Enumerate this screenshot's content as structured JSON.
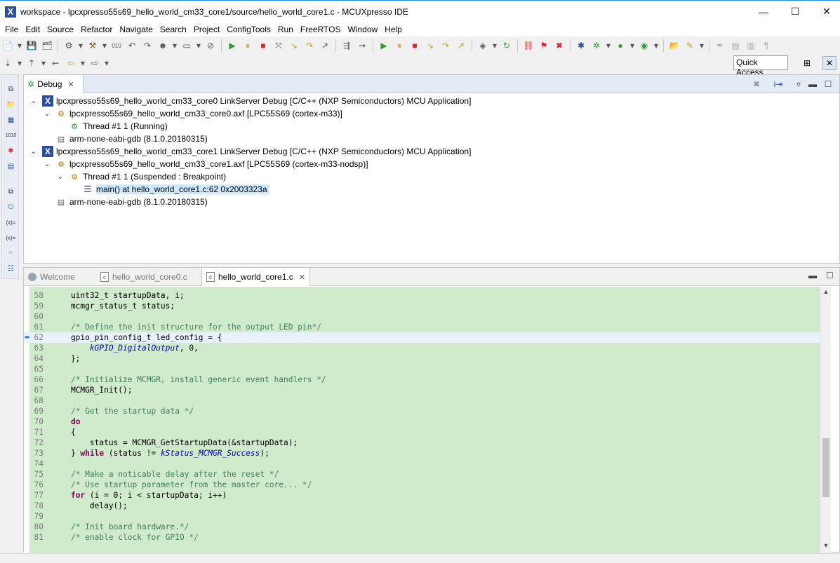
{
  "window": {
    "title": "workspace - lpcxpresso55s69_hello_world_cm33_core1/source/hello_world_core1.c - MCUXpresso IDE",
    "minimize": "—",
    "maximize": "☐",
    "close": "✕"
  },
  "menu": [
    "File",
    "Edit",
    "Source",
    "Refactor",
    "Navigate",
    "Search",
    "Project",
    "ConfigTools",
    "Run",
    "FreeRTOS",
    "Window",
    "Help"
  ],
  "toolbar": {
    "quick_access": "Quick Access"
  },
  "debug_view": {
    "tab_label": "Debug",
    "tree": [
      {
        "level": 0,
        "twisty": "⌄",
        "icon": "launch-icon",
        "glyph": "X",
        "text": "lpcxpresso55s69_hello_world_cm33_core0 LinkServer Debug [C/C++ (NXP Semiconductors) MCU Application]"
      },
      {
        "level": 1,
        "twisty": "⌄",
        "icon": "process-icon",
        "glyph": "⚙",
        "text": "lpcxpresso55s69_hello_world_cm33_core0.axf [LPC55S69 (cortex-m33)]"
      },
      {
        "level": 2,
        "twisty": "",
        "icon": "thread-running-icon",
        "glyph": "⚙",
        "text": "Thread #1 1 (Running)"
      },
      {
        "level": 1,
        "twisty": "",
        "icon": "gdb-icon",
        "glyph": "▤",
        "text": "arm-none-eabi-gdb (8.1.0.20180315)"
      },
      {
        "level": 0,
        "twisty": "⌄",
        "icon": "launch-icon",
        "glyph": "X",
        "text": "lpcxpresso55s69_hello_world_cm33_core1 LinkServer Debug [C/C++ (NXP Semiconductors) MCU Application]"
      },
      {
        "level": 1,
        "twisty": "⌄",
        "icon": "process-icon",
        "glyph": "⚙",
        "text": "lpcxpresso55s69_hello_world_cm33_core1.axf [LPC55S69 (cortex-m33-nodsp)]"
      },
      {
        "level": 2,
        "twisty": "⌄",
        "icon": "thread-suspended-icon",
        "glyph": "⚙",
        "text": "Thread #1 1 (Suspended : Breakpoint)"
      },
      {
        "level": 3,
        "twisty": "",
        "icon": "stack-frame-icon",
        "glyph": "☰",
        "text": "main() at hello_world_core1.c:62 0x2003323a",
        "selected": true
      },
      {
        "level": 1,
        "twisty": "",
        "icon": "gdb-icon",
        "glyph": "▤",
        "text": "arm-none-eabi-gdb (8.1.0.20180315)"
      }
    ]
  },
  "editor": {
    "tabs": [
      {
        "label": "Welcome",
        "kind": "welcome",
        "active": false
      },
      {
        "label": "hello_world_core0.c",
        "kind": "c-file",
        "active": false
      },
      {
        "label": "hello_world_core1.c",
        "kind": "c-file",
        "active": true
      }
    ],
    "current_line": "62",
    "lines": [
      {
        "n": "58",
        "code": "    uint32_t startupData, i;"
      },
      {
        "n": "59",
        "code": "    mcmgr_status_t status;"
      },
      {
        "n": "60",
        "code": ""
      },
      {
        "n": "61",
        "code": "    /* Define the init structure for the output LED pin*/"
      },
      {
        "n": "62",
        "code": "    gpio_pin_config_t led_config = {"
      },
      {
        "n": "63",
        "code": "        kGPIO_DigitalOutput, 0,"
      },
      {
        "n": "64",
        "code": "    };"
      },
      {
        "n": "65",
        "code": ""
      },
      {
        "n": "66",
        "code": "    /* Initialize MCMGR, install generic event handlers */"
      },
      {
        "n": "67",
        "code": "    MCMGR_Init();"
      },
      {
        "n": "68",
        "code": ""
      },
      {
        "n": "69",
        "code": "    /* Get the startup data */"
      },
      {
        "n": "70",
        "code": "    do"
      },
      {
        "n": "71",
        "code": "    {"
      },
      {
        "n": "72",
        "code": "        status = MCMGR_GetStartupData(&startupData);"
      },
      {
        "n": "73",
        "code": "    } while (status != kStatus_MCMGR_Success);"
      },
      {
        "n": "74",
        "code": ""
      },
      {
        "n": "75",
        "code": "    /* Make a noticable delay after the reset */"
      },
      {
        "n": "76",
        "code": "    /* Use startup parameter from the master core... */"
      },
      {
        "n": "77",
        "code": "    for (i = 0; i < startupData; i++)"
      },
      {
        "n": "78",
        "code": "        delay();"
      },
      {
        "n": "79",
        "code": ""
      },
      {
        "n": "80",
        "code": "    /* Init board hardware.*/"
      },
      {
        "n": "81",
        "code": "    /* enable clock for GPIO */"
      }
    ]
  }
}
